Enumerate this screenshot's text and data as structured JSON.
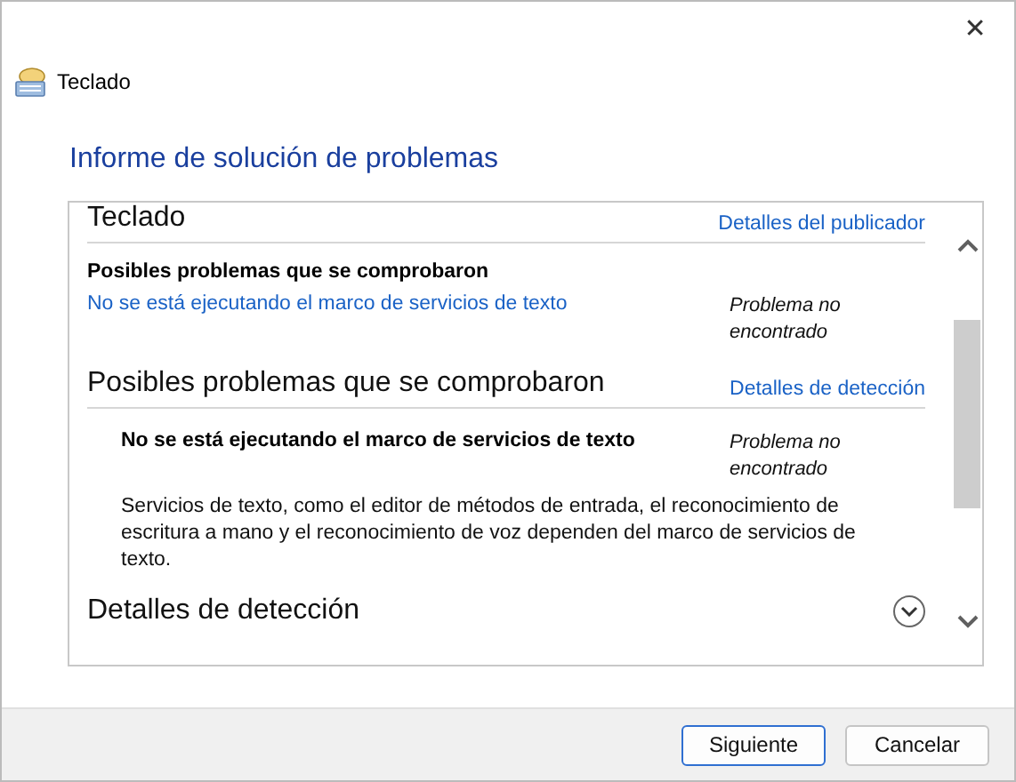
{
  "window": {
    "title": "Teclado",
    "close": "✕"
  },
  "heading": "Informe de solución de problemas",
  "report": [
    {
      "kind": "section",
      "title": "Teclado",
      "link": "Detalles del publicador"
    },
    {
      "kind": "subheading",
      "text": "Posibles problemas que se comprobaron"
    },
    {
      "kind": "problem-link",
      "text": "No se está ejecutando el marco de servicios de texto",
      "status": "Problema no encontrado"
    },
    {
      "kind": "section",
      "title": "Posibles problemas que se comprobaron",
      "link": "Detalles de detección"
    },
    {
      "kind": "problem-detail",
      "text": "No se está ejecutando el marco de servicios de texto",
      "status": "Problema no encontrado",
      "description": "Servicios de texto, como el editor de métodos de entrada, el reconocimiento de escritura a mano y el reconocimiento de voz dependen del marco de servicios de texto."
    },
    {
      "kind": "collapsed-section",
      "title": "Detalles de detección",
      "expanded": false
    }
  ],
  "buttons": [
    {
      "label": "Siguiente",
      "selected": true
    },
    {
      "label": "Cancelar",
      "selected": false
    }
  ]
}
